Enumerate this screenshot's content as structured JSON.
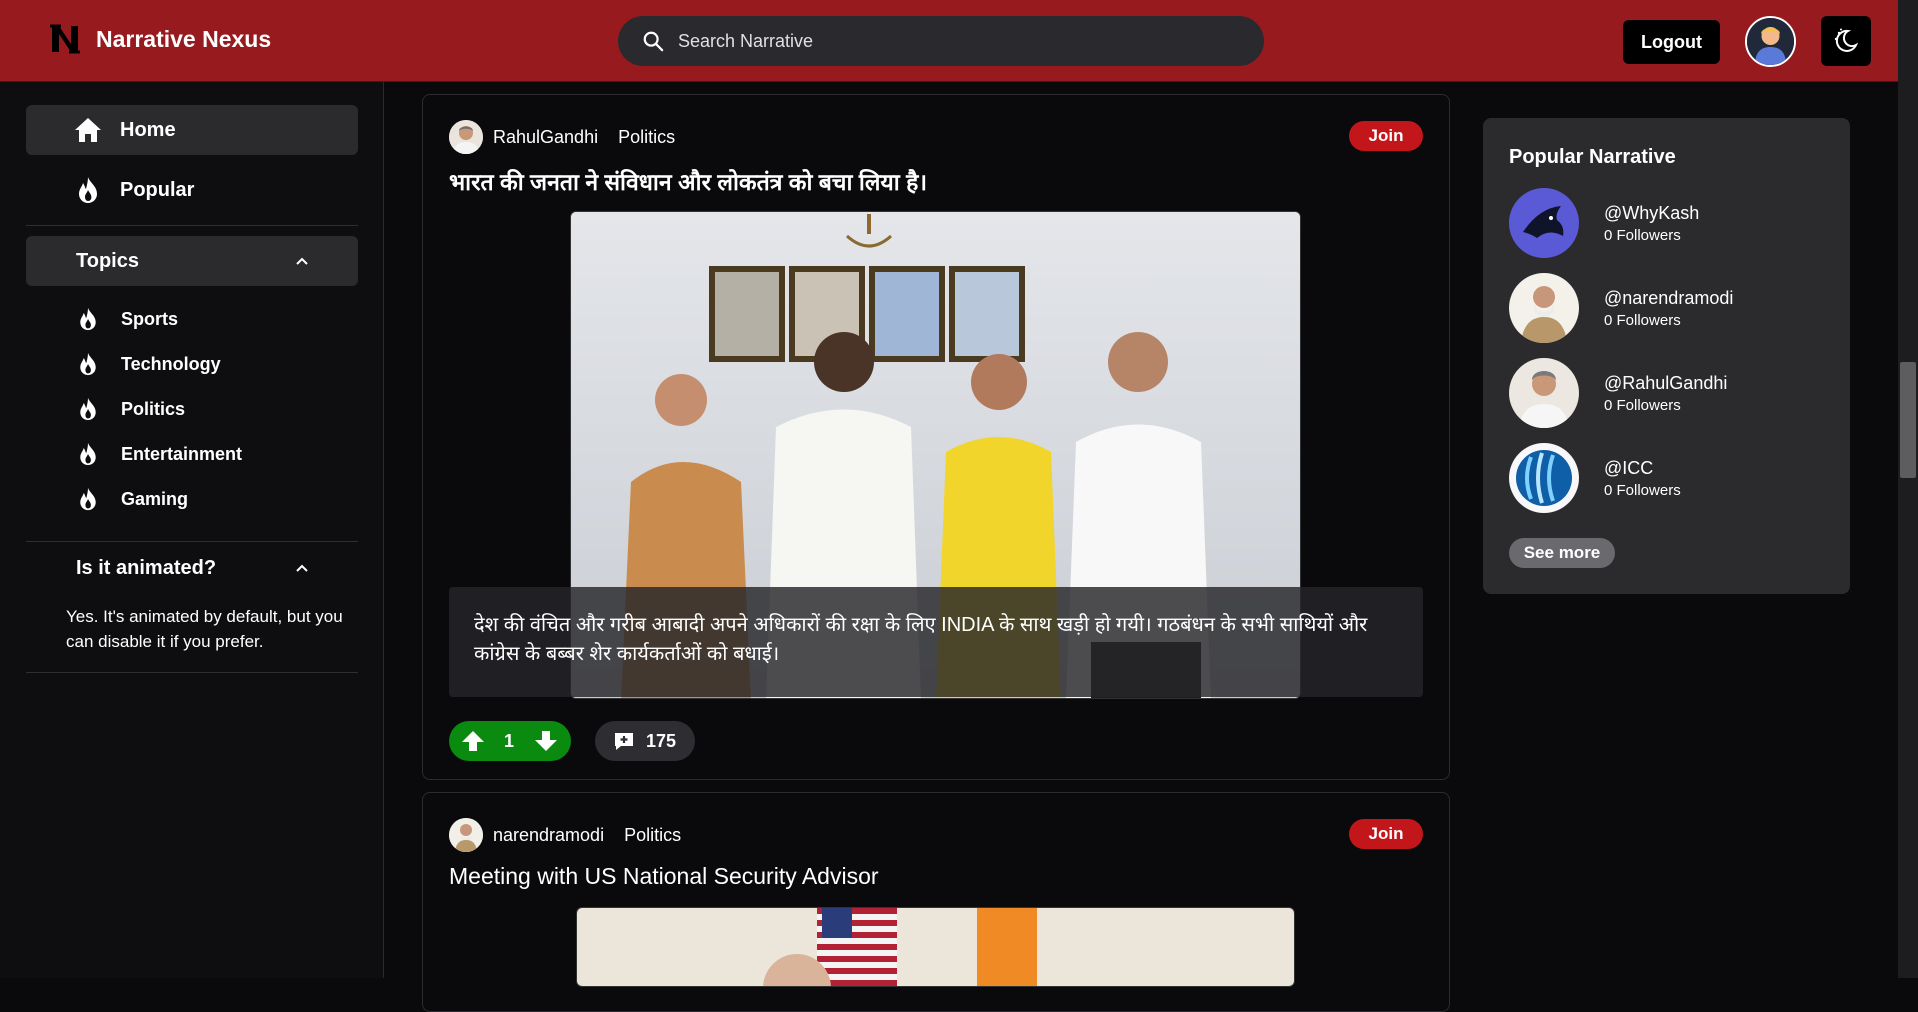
{
  "header": {
    "brand_name": "Narrative Nexus",
    "search_placeholder": "Search Narrative",
    "logout_label": "Logout"
  },
  "sidebar": {
    "nav": [
      {
        "label": "Home",
        "icon": "home-icon",
        "active": true
      },
      {
        "label": "Popular",
        "icon": "flame-icon",
        "active": false
      }
    ],
    "topics_label": "Topics",
    "topics": [
      {
        "label": "Sports",
        "icon": "flame-icon"
      },
      {
        "label": "Technology",
        "icon": "flame-icon"
      },
      {
        "label": "Politics",
        "icon": "flame-icon"
      },
      {
        "label": "Entertainment",
        "icon": "flame-icon"
      },
      {
        "label": "Gaming",
        "icon": "flame-icon"
      }
    ],
    "faq": {
      "question": "Is it animated?",
      "answer": "Yes. It's animated by default, but you can disable it if you prefer."
    }
  },
  "feed": {
    "posts": [
      {
        "username": "RahulGandhi",
        "topic": "Politics",
        "join_label": "Join",
        "title": "भारत की जनता ने संविधान और लोकतंत्र को बचा लिया है।",
        "caption": "देश की वंचित और गरीब आबादी अपने अधिकारों की रक्षा के लिए INDIA के साथ खड़ी हो गयी। गठबंधन के सभी साथियों और कांग्रेस के बब्बर शेर कार्यकर्ताओं को बधाई।",
        "votes": "1",
        "comments": "175"
      },
      {
        "username": "narendramodi",
        "topic": "Politics",
        "join_label": "Join",
        "title": "Meeting with US National Security Advisor"
      }
    ]
  },
  "popular": {
    "title": "Popular Narrative",
    "items": [
      {
        "handle": "@WhyKash",
        "followers": "0 Followers"
      },
      {
        "handle": "@narendramodi",
        "followers": "0 Followers"
      },
      {
        "handle": "@RahulGandhi",
        "followers": "0 Followers"
      },
      {
        "handle": "@ICC",
        "followers": "0 Followers"
      }
    ],
    "see_more_label": "See more"
  },
  "colors": {
    "header_bg": "#971b1e",
    "join_bg": "#c3161b",
    "vote_bg": "#0a8a0e",
    "panel_bg": "#2b2b2e"
  }
}
